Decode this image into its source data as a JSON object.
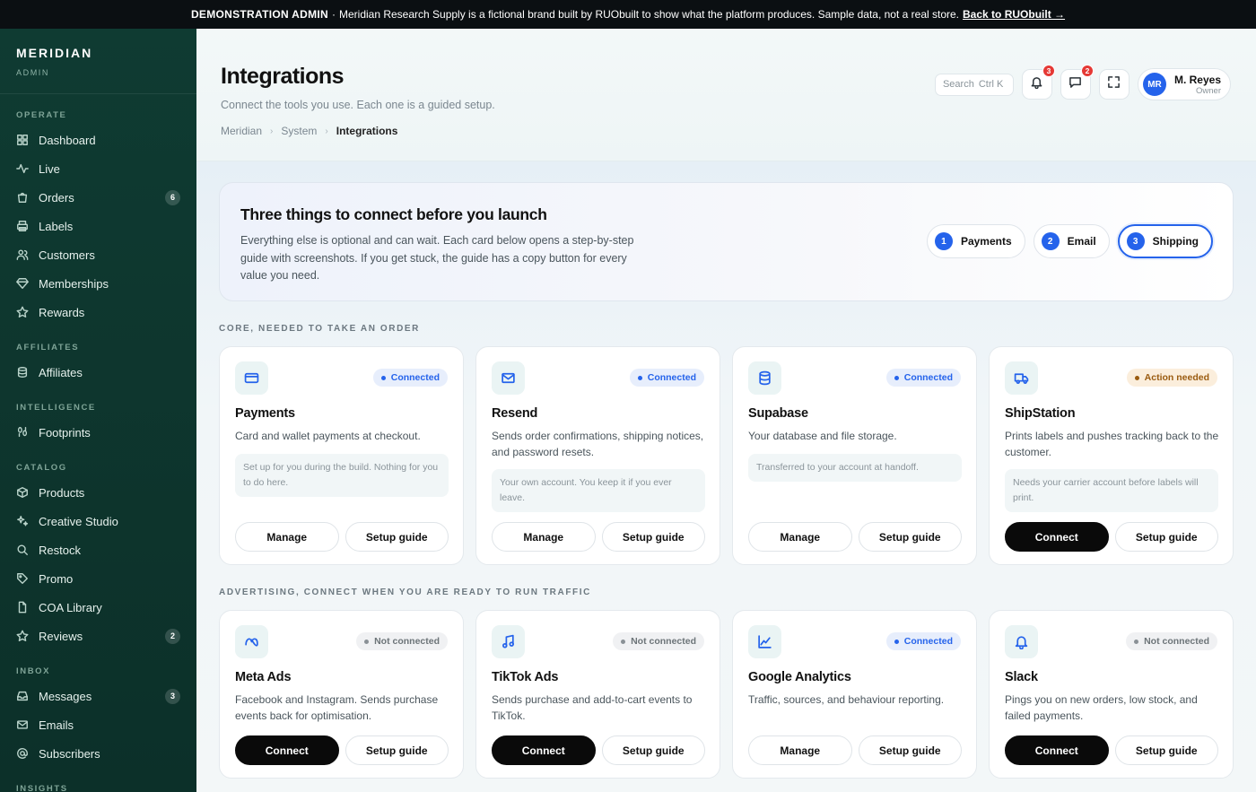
{
  "banner": {
    "strong": "DEMONSTRATION ADMIN",
    "sep": "·",
    "text": "Meridian Research Supply is a fictional brand built by RUObuilt to show what the platform produces. Sample data, not a real store.",
    "link": "Back to RUObuilt →"
  },
  "brand": {
    "name": "MERIDIAN",
    "sub": "ADMIN"
  },
  "sidebar": {
    "sections": {
      "operate": "OPERATE",
      "affiliates": "AFFILIATES",
      "intelligence": "INTELLIGENCE",
      "catalog": "CATALOG",
      "inbox": "INBOX",
      "insights": "INSIGHTS"
    },
    "items": {
      "dashboard": "Dashboard",
      "live": "Live",
      "orders": "Orders",
      "orders_count": "6",
      "labels": "Labels",
      "customers": "Customers",
      "memberships": "Memberships",
      "rewards": "Rewards",
      "affiliates": "Affiliates",
      "footprints": "Footprints",
      "products": "Products",
      "creative_studio": "Creative Studio",
      "restock": "Restock",
      "promo": "Promo",
      "coa_library": "COA Library",
      "reviews": "Reviews",
      "reviews_count": "2",
      "messages": "Messages",
      "messages_count": "3",
      "emails": "Emails",
      "subscribers": "Subscribers"
    }
  },
  "header": {
    "title": "Integrations",
    "subtitle": "Connect the tools you use. Each one is a guided setup.",
    "breadcrumb": [
      "Meridian",
      "System",
      "Integrations"
    ],
    "search_label": "Search",
    "search_kbd": "Ctrl K",
    "notifications_count": "3",
    "messages_count": "2",
    "user": {
      "initials": "MR",
      "name": "M. Reyes",
      "role": "Owner"
    }
  },
  "hero": {
    "title": "Three things to connect before you launch",
    "text": "Everything else is optional and can wait. Each card below opens a step-by-step guide with screenshots. If you get stuck, the guide has a copy button for every value you need.",
    "steps": [
      {
        "n": "1",
        "label": "Payments"
      },
      {
        "n": "2",
        "label": "Email"
      },
      {
        "n": "3",
        "label": "Shipping"
      }
    ]
  },
  "sections": {
    "core": "CORE, NEEDED TO TAKE AN ORDER",
    "advertising": "ADVERTISING, CONNECT WHEN YOU ARE READY TO RUN TRAFFIC"
  },
  "cards": [
    {
      "icon": "credit-card-icon",
      "status": "Connected",
      "title": "Payments",
      "desc": "Card and wallet payments at checkout.",
      "note": "Set up for you during the build. Nothing for you to do here.",
      "primary": "Manage",
      "secondary": "Setup guide"
    },
    {
      "icon": "mail-icon",
      "status": "Connected",
      "title": "Resend",
      "desc": "Sends order confirmations, shipping notices, and password resets.",
      "note": "Your own account. You keep it if you ever leave.",
      "primary": "Manage",
      "secondary": "Setup guide"
    },
    {
      "icon": "database-icon",
      "status": "Connected",
      "title": "Supabase",
      "desc": "Your database and file storage.",
      "note": "Transferred to your account at handoff.",
      "primary": "Manage",
      "secondary": "Setup guide"
    },
    {
      "icon": "truck-icon",
      "status": "Action needed",
      "title": "ShipStation",
      "desc": "Prints labels and pushes tracking back to the customer.",
      "note": "Needs your carrier account before labels will print.",
      "primary": "Connect",
      "secondary": "Setup guide"
    },
    {
      "icon": "meta-icon",
      "status": "Not connected",
      "title": "Meta Ads",
      "desc": "Facebook and Instagram. Sends purchase events back for optimisation.",
      "primary": "Connect",
      "secondary": "Setup guide"
    },
    {
      "icon": "music-note-icon",
      "status": "Not connected",
      "title": "TikTok Ads",
      "desc": "Sends purchase and add-to-cart events to TikTok.",
      "primary": "Connect",
      "secondary": "Setup guide"
    },
    {
      "icon": "chart-icon",
      "status": "Connected",
      "title": "Google Analytics",
      "desc": "Traffic, sources, and behaviour reporting.",
      "primary": "Manage",
      "secondary": "Setup guide"
    },
    {
      "icon": "bell-icon",
      "status": "Not connected",
      "title": "Slack",
      "desc": "Pings you on new orders, low stock, and failed payments.",
      "primary": "Connect",
      "secondary": "Setup guide"
    }
  ]
}
